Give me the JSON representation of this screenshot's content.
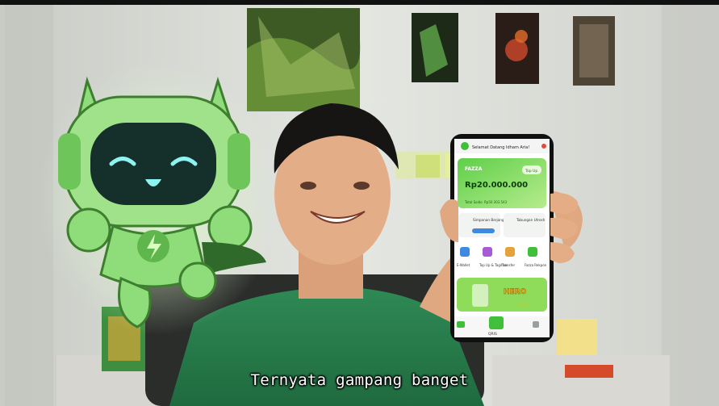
{
  "subtitle": "Ternyata gampang banget",
  "phone": {
    "greeting": "Selamat Datang Idham Aria!",
    "account_name": "FAZZA",
    "balance": "Rp20.000.000",
    "topup_label": "Top Up",
    "total_label": "Total Saldo",
    "total_value": "Rp50.303.543",
    "savings": [
      "Simpanan Berjangka",
      "Tabungan Utrosh"
    ],
    "menu": [
      "E-Wallet",
      "Top Up & Tagihan",
      "Transfer",
      "Fazza Rekpon"
    ],
    "promo": "HERO",
    "promo_rate": "9%",
    "qris": "QRIS"
  },
  "colors": {
    "accent_green": "#3fbf3a",
    "mascot_green": "#8fdc7a"
  }
}
